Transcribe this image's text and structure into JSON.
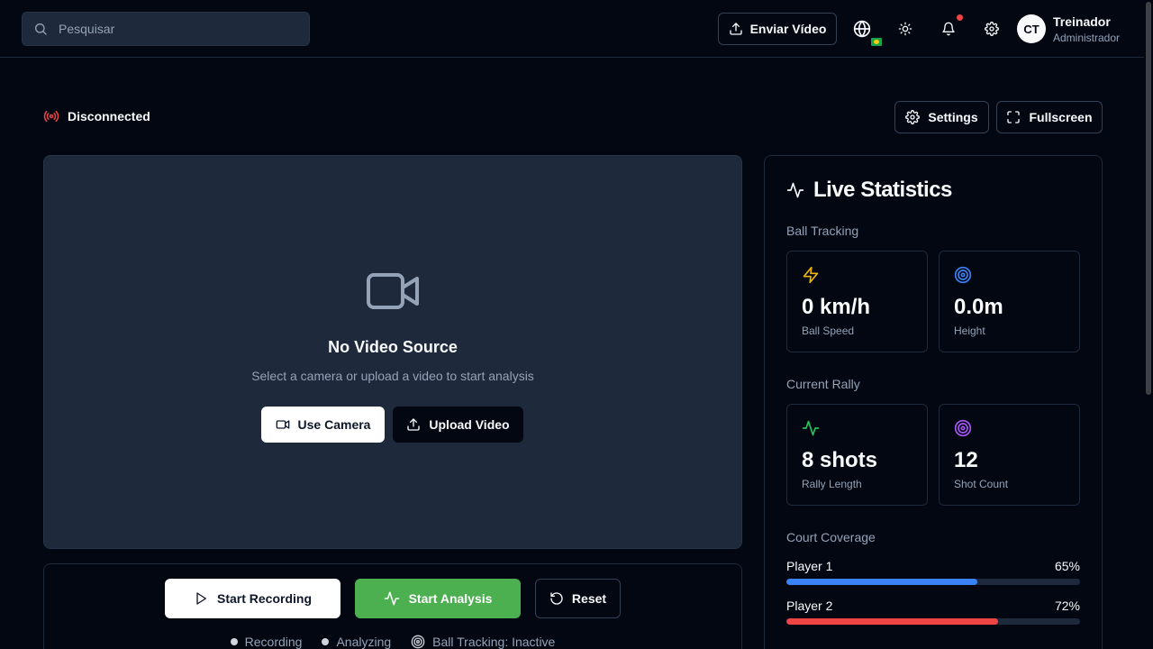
{
  "header": {
    "search_placeholder": "Pesquisar",
    "upload_label": "Enviar Vídeo",
    "user": {
      "initials": "CT",
      "name": "Treinador",
      "role": "Administrador"
    }
  },
  "status": {
    "connection": "Disconnected",
    "color": "#ef4444"
  },
  "toolbar": {
    "settings_label": "Settings",
    "fullscreen_label": "Fullscreen"
  },
  "video": {
    "title": "No Video Source",
    "subtitle": "Select a camera or upload a video to start analysis",
    "use_camera_label": "Use Camera",
    "upload_video_label": "Upload Video"
  },
  "controls": {
    "start_recording_label": "Start Recording",
    "start_analysis_label": "Start Analysis",
    "reset_label": "Reset",
    "indicators": {
      "recording": "Recording",
      "analyzing": "Analyzing",
      "ball_tracking": "Ball Tracking: Inactive"
    }
  },
  "stats": {
    "title": "Live Statistics",
    "ball_tracking": {
      "label": "Ball Tracking",
      "speed": {
        "value": "0 km/h",
        "label": "Ball Speed",
        "icon": "lightning-icon",
        "color": "#eab308"
      },
      "height": {
        "value": "0.0m",
        "label": "Height",
        "icon": "target-icon",
        "color": "#3b82f6"
      }
    },
    "rally": {
      "label": "Current Rally",
      "length": {
        "value": "8 shots",
        "label": "Rally Length",
        "icon": "activity-icon",
        "color": "#22c55e"
      },
      "count": {
        "value": "12",
        "label": "Shot Count",
        "icon": "target-icon",
        "color": "#a855f7"
      }
    },
    "coverage": {
      "label": "Court Coverage",
      "players": [
        {
          "name": "Player 1",
          "percent": "65%",
          "value": 0.65,
          "color": "#3b82f6"
        },
        {
          "name": "Player 2",
          "percent": "72%",
          "value": 0.72,
          "color": "#ef4444"
        }
      ]
    }
  }
}
